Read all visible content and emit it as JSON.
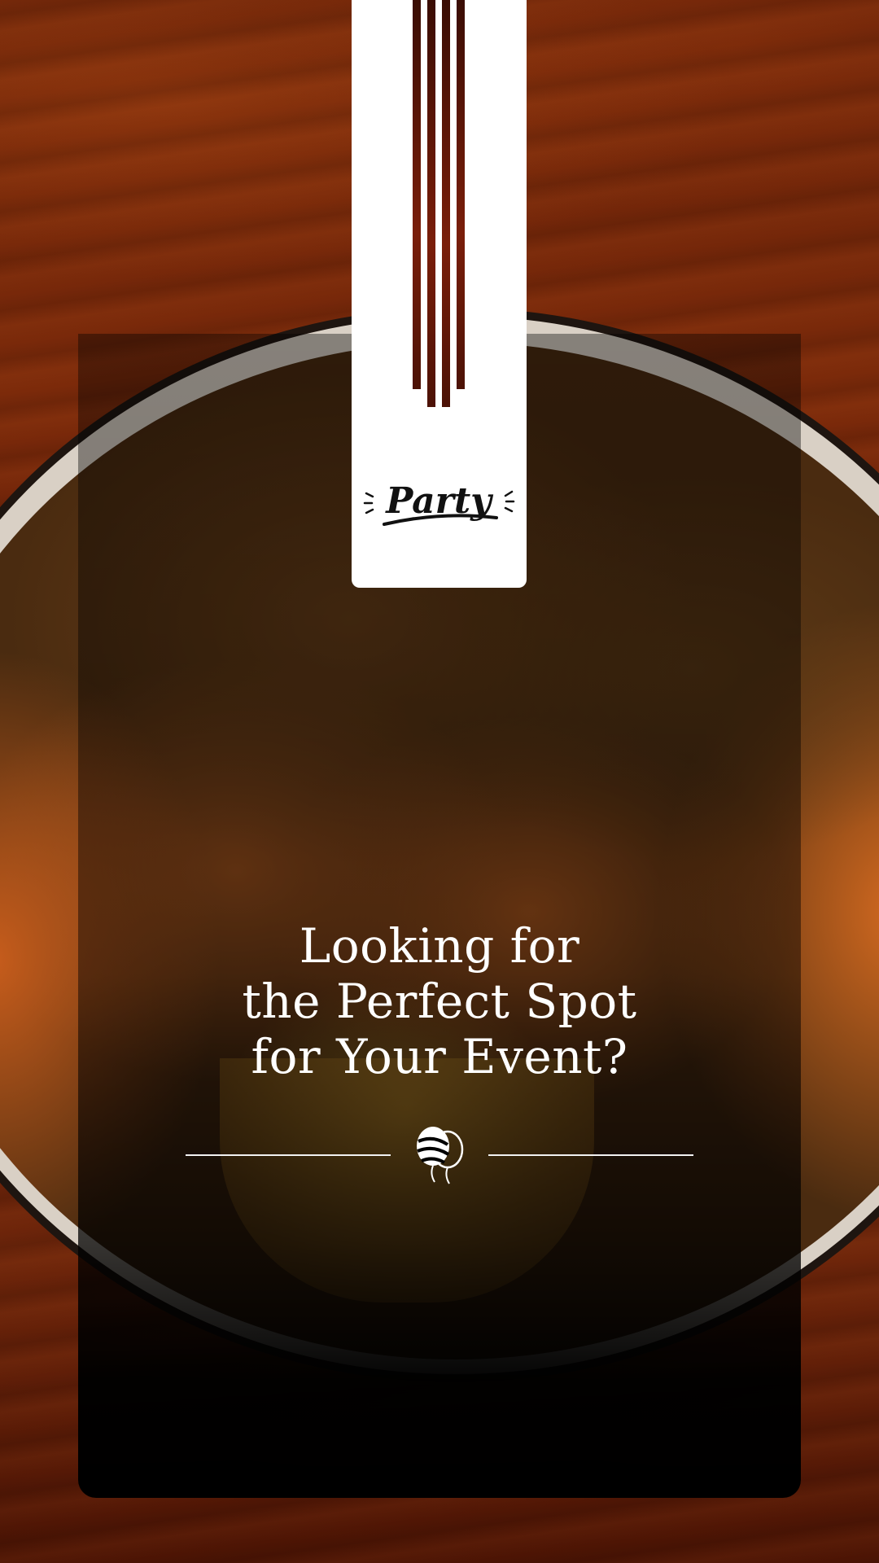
{
  "brand": {
    "logo_text": "Party"
  },
  "heading": {
    "line1": "Looking for",
    "line2": "the Perfect Spot",
    "line3": "for Your Event?"
  },
  "colors": {
    "banner": "#ffffff",
    "accent_stripe": "#7a1e0a",
    "text": "#ffffff"
  },
  "icons": {
    "divider_icon": "balloons-icon"
  }
}
